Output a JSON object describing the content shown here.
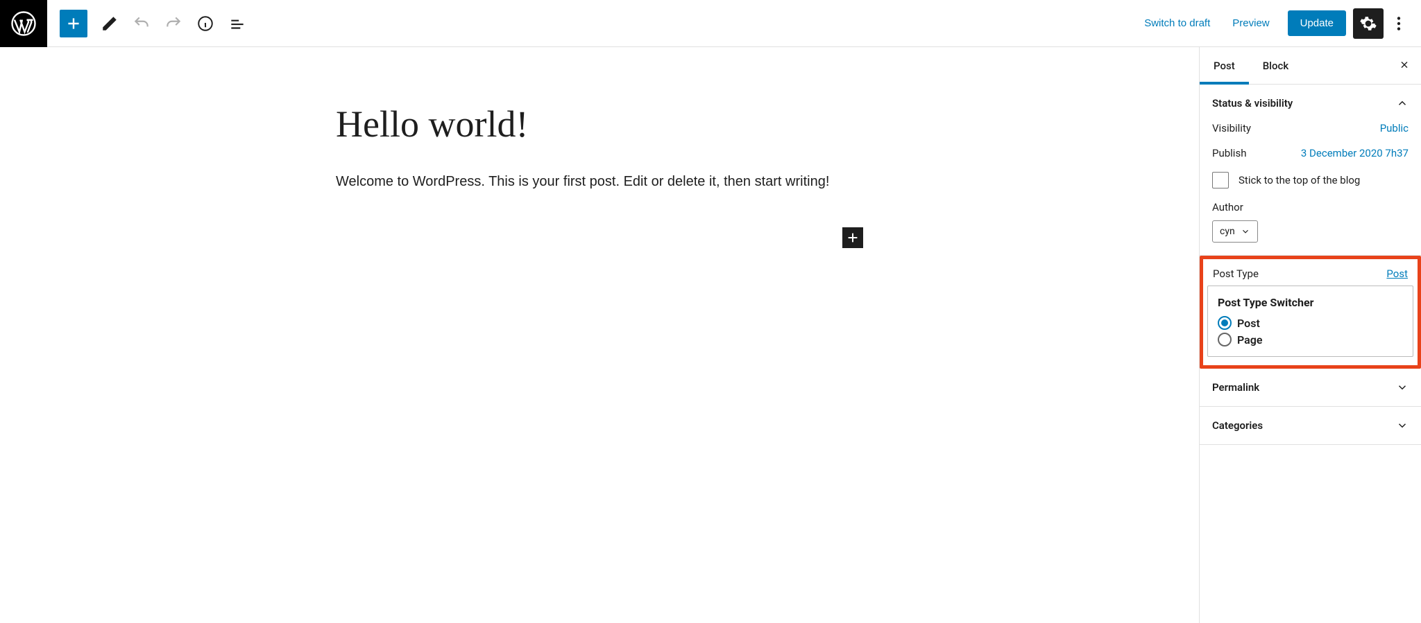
{
  "topbar": {
    "switch_to_draft": "Switch to draft",
    "preview": "Preview",
    "update": "Update"
  },
  "editor": {
    "title": "Hello world!",
    "body": "Welcome to WordPress. This is your first post. Edit or delete it, then start writing!"
  },
  "sidebar": {
    "tabs": {
      "post": "Post",
      "block": "Block"
    },
    "status_panel": {
      "title": "Status & visibility",
      "visibility_label": "Visibility",
      "visibility_value": "Public",
      "publish_label": "Publish",
      "publish_value": "3 December 2020 7h37",
      "stick_label": "Stick to the top of the blog",
      "author_label": "Author",
      "author_value": "cyn"
    },
    "post_type": {
      "heading": "Post Type",
      "link": "Post",
      "switcher_title": "Post Type Switcher",
      "option_post": "Post",
      "option_page": "Page"
    },
    "permalink": "Permalink",
    "categories": "Categories"
  }
}
